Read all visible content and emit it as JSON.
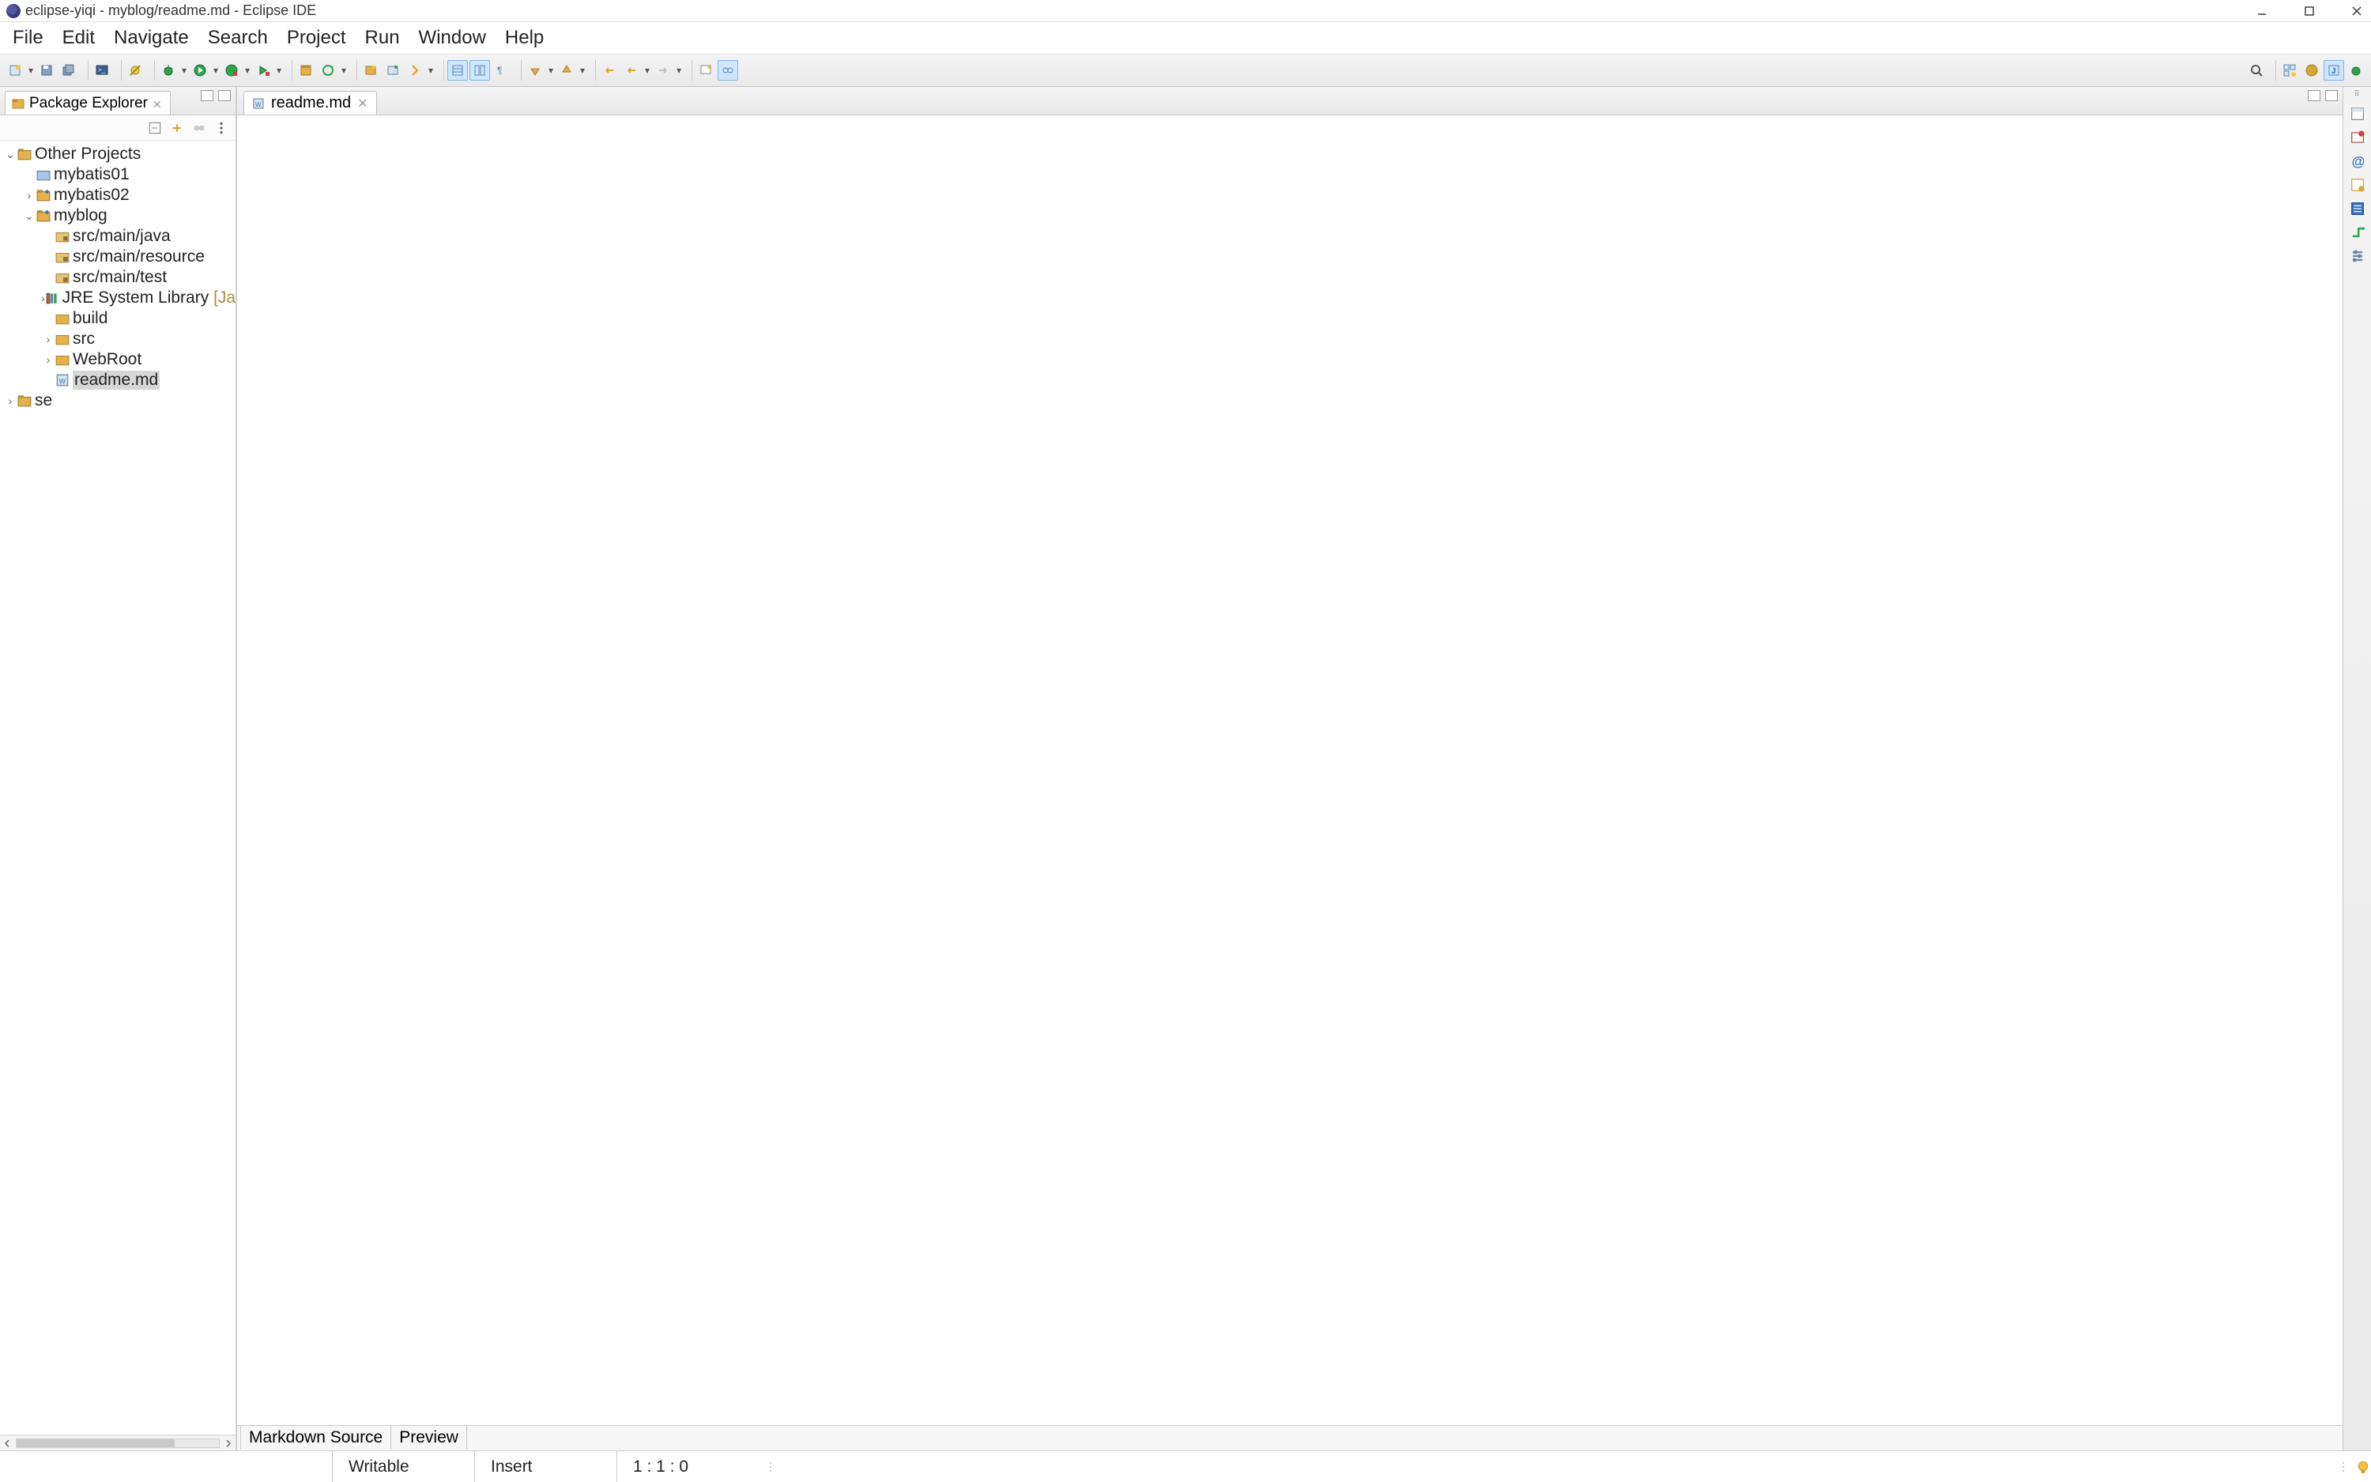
{
  "window": {
    "title": "eclipse-yiqi - myblog/readme.md - Eclipse IDE"
  },
  "menu": [
    "File",
    "Edit",
    "Navigate",
    "Search",
    "Project",
    "Run",
    "Window",
    "Help"
  ],
  "package_explorer": {
    "title": "Package Explorer",
    "root": {
      "label": "Other Projects",
      "children": [
        {
          "label": "mybatis01",
          "kind": "folder-closed"
        },
        {
          "label": "mybatis02",
          "kind": "project",
          "expandable": true
        },
        {
          "label": "myblog",
          "kind": "project",
          "expanded": true,
          "children": [
            {
              "label": "src/main/java",
              "kind": "source-folder"
            },
            {
              "label": "src/main/resource",
              "kind": "source-folder"
            },
            {
              "label": "src/main/test",
              "kind": "source-folder"
            },
            {
              "label": "JRE System Library",
              "suffix": "[JavaS",
              "kind": "library",
              "expandable": true
            },
            {
              "label": "build",
              "kind": "folder"
            },
            {
              "label": "src",
              "kind": "folder",
              "expandable": true
            },
            {
              "label": "WebRoot",
              "kind": "folder",
              "expandable": true
            },
            {
              "label": "readme.md",
              "kind": "file-md",
              "selected": true
            }
          ]
        },
        {
          "label": "se",
          "kind": "project",
          "expandable": true
        }
      ]
    }
  },
  "editor": {
    "tabs": [
      {
        "title": "readme.md",
        "kind": "markdown"
      }
    ],
    "bottom_tabs": [
      "Markdown Source",
      "Preview"
    ]
  },
  "statusbar": {
    "writable": "Writable",
    "mode": "Insert",
    "position": "1 : 1 : 0"
  }
}
